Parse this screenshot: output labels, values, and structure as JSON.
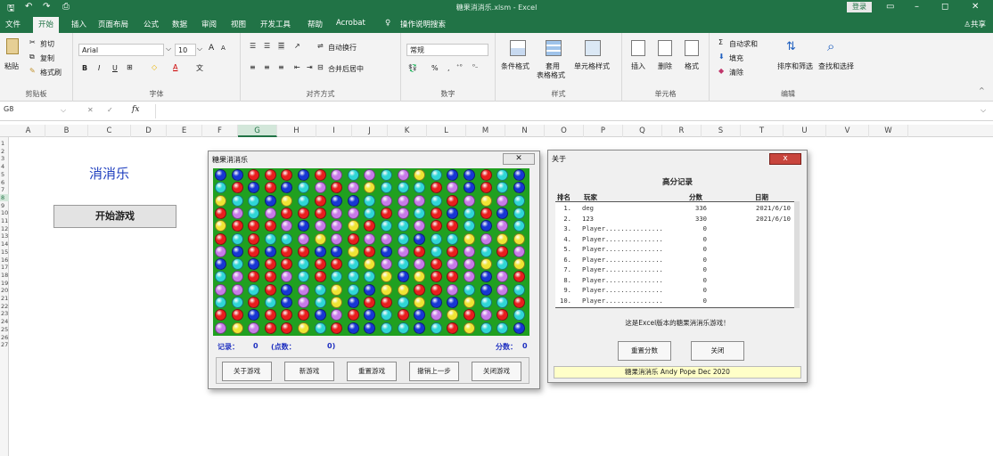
{
  "window": {
    "title": "糖果消消乐.xlsm  -  Excel",
    "login_label": "登录",
    "share_label": "共享"
  },
  "menu": [
    "文件",
    "开始",
    "插入",
    "页面布局",
    "公式",
    "数据",
    "审阅",
    "视图",
    "开发工具",
    "帮助",
    "Acrobat"
  ],
  "tell_me": "操作说明搜索",
  "ribbon": {
    "clipboard": {
      "paste": "粘贴",
      "cut": "剪切",
      "copy": "复制",
      "format_painter": "格式刷",
      "label": "剪贴板"
    },
    "font": {
      "name": "Arial",
      "size": "10",
      "bold": "B",
      "italic": "I",
      "underline": "U",
      "grow": "A",
      "shrink": "A",
      "label": "字体"
    },
    "alignment": {
      "wrap": "自动换行",
      "merge": "合并后居中",
      "label": "对齐方式"
    },
    "number": {
      "format": "常规",
      "percent": "%",
      "comma": ",",
      "label": "数字"
    },
    "styles": {
      "conditional": "条件格式",
      "table_line1": "套用",
      "table_line2": "表格格式",
      "cell_styles": "单元格样式",
      "label": "样式"
    },
    "cells": {
      "insert": "插入",
      "delete": "删除",
      "format": "格式",
      "label": "单元格"
    },
    "editing": {
      "autosum": "自动求和",
      "fill": "填充",
      "clear": "清除",
      "sort": "排序和筛选",
      "find": "查找和选择",
      "label": "编辑"
    }
  },
  "formula_bar": {
    "name_box": "G8",
    "fx": "fx"
  },
  "columns": [
    "A",
    "B",
    "C",
    "D",
    "E",
    "F",
    "G",
    "H",
    "I",
    "J",
    "K",
    "L",
    "M",
    "N",
    "O",
    "P",
    "Q",
    "R",
    "S",
    "T",
    "U",
    "V",
    "W"
  ],
  "selected_column": "G",
  "rows": [
    "1",
    "2",
    "3",
    "4",
    "5",
    "6",
    "7",
    "8",
    "9",
    "10",
    "11",
    "12",
    "13",
    "14",
    "15",
    "16",
    "17",
    "18",
    "19",
    "20",
    "21",
    "22",
    "23",
    "24",
    "25",
    "26",
    "27"
  ],
  "selected_row": "8",
  "sheet": {
    "title": "消消乐",
    "start_button": "开始游戏"
  },
  "game_dialog": {
    "title": "糖果消消乐",
    "record_label": "记录：",
    "record_value": "0",
    "points_label": "(点数：",
    "points_value": "0)",
    "score_label": "分数：",
    "score_value": "0",
    "buttons": [
      "关于游戏",
      "新游戏",
      "重置游戏",
      "撤销上一步",
      "关闭游戏"
    ],
    "board": [
      "BBRRRBRPCPCPYCBBRCB",
      "CRBRBCPRPYCCCRPBRCB",
      "YCCBYCRBBCPPPCRPYPC",
      "RPCPRRRPPCRPCRBCRBC",
      "YRRRPBPPYRCCPRRCBPC",
      "RCRCCPYPRPPCBCCYPYY",
      "PBRBRRBBYRBPRCRPCRP",
      "BCBRRCRRCYPCPRPPYCY",
      "CPRRPCRCCCYBYRRPBPR",
      "PPCRBPCYCBYYRRPCBPC",
      "CCRCBPCYBRRCYBBYCCR",
      "RRBRRRBPRBCRBPYRPRC",
      "PYPRRYCRBBCCBCRYCCB"
    ],
    "colors": {
      "B": "#1737d4",
      "R": "#e81e1e",
      "C": "#2fd6d6",
      "P": "#c77be8",
      "Y": "#efe433",
      "board": "#20a020"
    }
  },
  "about_dialog": {
    "title": "关于",
    "close_glyph": "x",
    "heading": "高分记录",
    "columns": [
      "排名",
      "玩家",
      "分数",
      "日期"
    ],
    "entries": [
      {
        "rank": "1.",
        "player": "deg",
        "score": "336",
        "date": "2021/6/10"
      },
      {
        "rank": "2.",
        "player": "123",
        "score": "330",
        "date": "2021/6/10"
      },
      {
        "rank": "3.",
        "player": "Player...............",
        "score": "0",
        "date": ""
      },
      {
        "rank": "4.",
        "player": "Player...............",
        "score": "0",
        "date": ""
      },
      {
        "rank": "5.",
        "player": "Player...............",
        "score": "0",
        "date": ""
      },
      {
        "rank": "6.",
        "player": "Player...............",
        "score": "0",
        "date": ""
      },
      {
        "rank": "7.",
        "player": "Player...............",
        "score": "0",
        "date": ""
      },
      {
        "rank": "8.",
        "player": "Player...............",
        "score": "0",
        "date": ""
      },
      {
        "rank": "9.",
        "player": "Player...............",
        "score": "0",
        "date": ""
      },
      {
        "rank": "10.",
        "player": "Player...............",
        "score": "0",
        "date": ""
      }
    ],
    "note": "这是Excel版本的糖果消消乐游戏！",
    "reset_button": "重置分数",
    "close_button": "关闭",
    "credit": "糖果消消乐 Andy Pope Dec 2020"
  }
}
